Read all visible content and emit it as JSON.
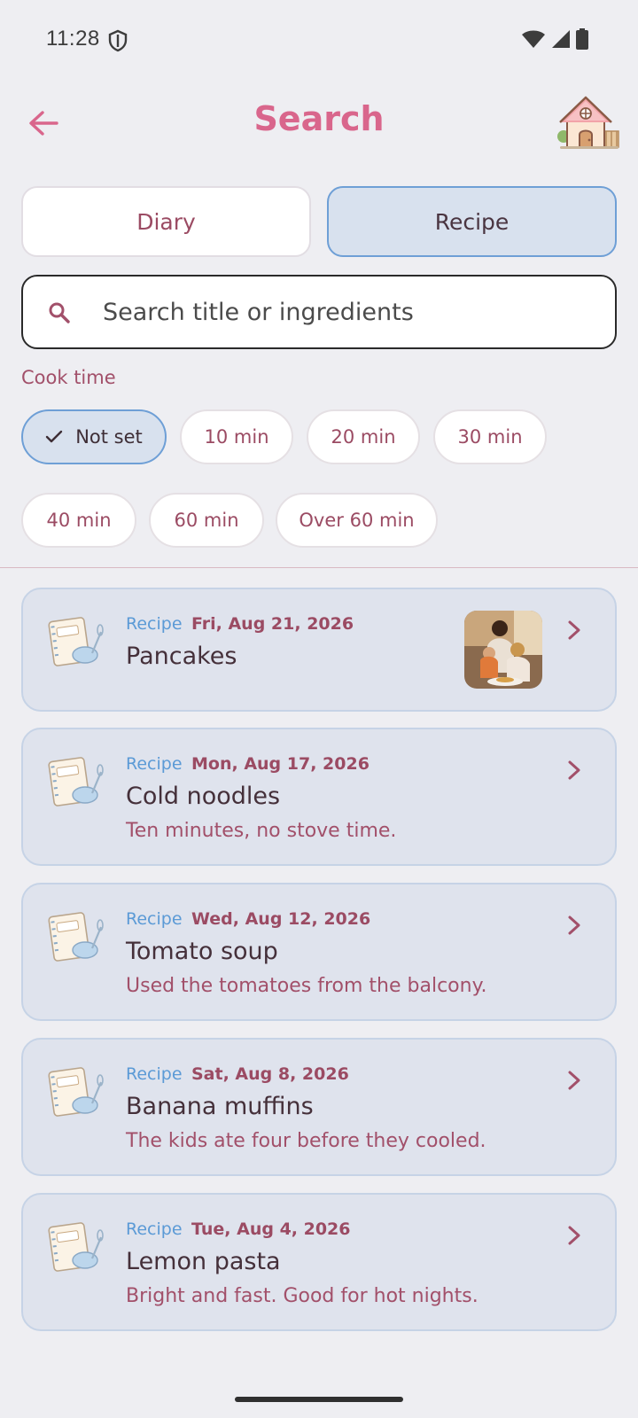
{
  "status": {
    "time": "11:28"
  },
  "header": {
    "title": "Search"
  },
  "tabs": {
    "diary": "Diary",
    "recipe": "Recipe"
  },
  "search": {
    "placeholder": "Search title or ingredients"
  },
  "cook_time": {
    "label": "Cook time",
    "options": [
      "Not set",
      "10 min",
      "20 min",
      "30 min",
      "40 min",
      "60 min",
      "Over 60 min"
    ],
    "selected": "Not set"
  },
  "results": [
    {
      "type": "Recipe",
      "date": "Fri, Aug 21, 2026",
      "title": "Pancakes",
      "desc": ""
    },
    {
      "type": "Recipe",
      "date": "Mon, Aug 17, 2026",
      "title": "Cold noodles",
      "desc": "Ten minutes, no stove time."
    },
    {
      "type": "Recipe",
      "date": "Wed, Aug 12, 2026",
      "title": "Tomato soup",
      "desc": "Used the tomatoes from the balcony."
    },
    {
      "type": "Recipe",
      "date": "Sat, Aug 8, 2026",
      "title": "Banana muffins",
      "desc": "The kids ate four before they cooled."
    },
    {
      "type": "Recipe",
      "date": "Tue, Aug 4, 2026",
      "title": "Lemon pasta",
      "desc": "Bright and fast. Good for hot nights."
    }
  ],
  "colors": {
    "accent": "#d9668c",
    "selected_bg": "#d8e1ee",
    "selected_border": "#6e9fd6",
    "card_bg": "#dfe3ed"
  }
}
